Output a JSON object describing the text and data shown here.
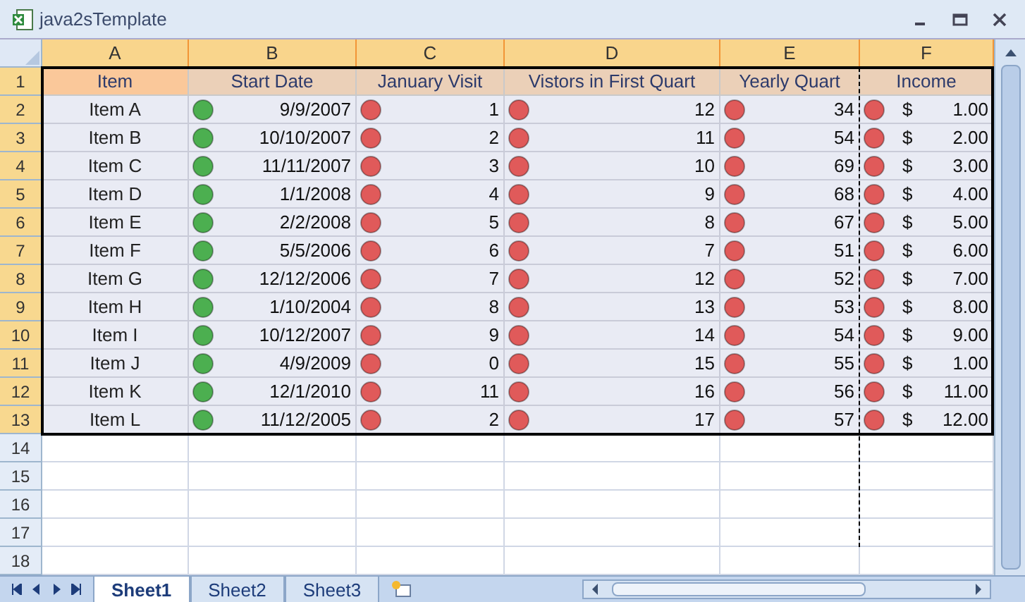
{
  "window": {
    "title": "java2sTemplate"
  },
  "columns": [
    {
      "label": "A",
      "selected": true
    },
    {
      "label": "B",
      "selected": true
    },
    {
      "label": "C",
      "selected": true
    },
    {
      "label": "D",
      "selected": true
    },
    {
      "label": "E",
      "selected": true
    },
    {
      "label": "F",
      "selected": true
    }
  ],
  "header_row": {
    "number": "1",
    "selected": true,
    "cells": [
      "Item",
      "Start Date",
      "January Visit",
      "Vistors in First Quart",
      "Yearly Quart",
      "Income"
    ]
  },
  "rows": [
    {
      "number": "2",
      "selected": true,
      "item": "Item A",
      "cells": [
        {
          "text": "9/9/2007",
          "color": "#4caf50"
        },
        {
          "text": "1",
          "color": "#e05a5a"
        },
        {
          "text": "12",
          "color": "#e05a5a"
        },
        {
          "text": "34",
          "color": "#e05a5a"
        },
        {
          "currency": "$",
          "text": "1.00",
          "color": "#e05a5a"
        }
      ]
    },
    {
      "number": "3",
      "selected": true,
      "item": "Item B",
      "cells": [
        {
          "text": "10/10/2007",
          "color": "#4caf50"
        },
        {
          "text": "2",
          "color": "#e05a5a"
        },
        {
          "text": "11",
          "color": "#e05a5a"
        },
        {
          "text": "54",
          "color": "#e05a5a"
        },
        {
          "currency": "$",
          "text": "2.00",
          "color": "#e05a5a"
        }
      ]
    },
    {
      "number": "4",
      "selected": true,
      "item": "Item C",
      "cells": [
        {
          "text": "11/11/2007",
          "color": "#4caf50"
        },
        {
          "text": "3",
          "color": "#e05a5a"
        },
        {
          "text": "10",
          "color": "#e05a5a"
        },
        {
          "text": "69",
          "color": "#e05a5a"
        },
        {
          "currency": "$",
          "text": "3.00",
          "color": "#e05a5a"
        }
      ]
    },
    {
      "number": "5",
      "selected": true,
      "item": "Item D",
      "cells": [
        {
          "text": "1/1/2008",
          "color": "#4caf50"
        },
        {
          "text": "4",
          "color": "#e05a5a"
        },
        {
          "text": "9",
          "color": "#e05a5a"
        },
        {
          "text": "68",
          "color": "#e05a5a"
        },
        {
          "currency": "$",
          "text": "4.00",
          "color": "#e05a5a"
        }
      ]
    },
    {
      "number": "6",
      "selected": true,
      "item": "Item E",
      "cells": [
        {
          "text": "2/2/2008",
          "color": "#4caf50"
        },
        {
          "text": "5",
          "color": "#e05a5a"
        },
        {
          "text": "8",
          "color": "#e05a5a"
        },
        {
          "text": "67",
          "color": "#e05a5a"
        },
        {
          "currency": "$",
          "text": "5.00",
          "color": "#e05a5a"
        }
      ]
    },
    {
      "number": "7",
      "selected": true,
      "item": "Item F",
      "cells": [
        {
          "text": "5/5/2006",
          "color": "#4caf50"
        },
        {
          "text": "6",
          "color": "#e05a5a"
        },
        {
          "text": "7",
          "color": "#e05a5a"
        },
        {
          "text": "51",
          "color": "#e05a5a"
        },
        {
          "currency": "$",
          "text": "6.00",
          "color": "#e05a5a"
        }
      ]
    },
    {
      "number": "8",
      "selected": true,
      "item": "Item G",
      "cells": [
        {
          "text": "12/12/2006",
          "color": "#4caf50"
        },
        {
          "text": "7",
          "color": "#e05a5a"
        },
        {
          "text": "12",
          "color": "#e05a5a"
        },
        {
          "text": "52",
          "color": "#e05a5a"
        },
        {
          "currency": "$",
          "text": "7.00",
          "color": "#e05a5a"
        }
      ]
    },
    {
      "number": "9",
      "selected": true,
      "item": "Item H",
      "cells": [
        {
          "text": "1/10/2004",
          "color": "#4caf50"
        },
        {
          "text": "8",
          "color": "#e05a5a"
        },
        {
          "text": "13",
          "color": "#e05a5a"
        },
        {
          "text": "53",
          "color": "#e05a5a"
        },
        {
          "currency": "$",
          "text": "8.00",
          "color": "#e05a5a"
        }
      ]
    },
    {
      "number": "10",
      "selected": true,
      "item": "Item I",
      "cells": [
        {
          "text": "10/12/2007",
          "color": "#4caf50"
        },
        {
          "text": "9",
          "color": "#e05a5a"
        },
        {
          "text": "14",
          "color": "#e05a5a"
        },
        {
          "text": "54",
          "color": "#e05a5a"
        },
        {
          "currency": "$",
          "text": "9.00",
          "color": "#e05a5a"
        }
      ]
    },
    {
      "number": "11",
      "selected": true,
      "item": "Item J",
      "cells": [
        {
          "text": "4/9/2009",
          "color": "#4caf50"
        },
        {
          "text": "0",
          "color": "#e05a5a"
        },
        {
          "text": "15",
          "color": "#e05a5a"
        },
        {
          "text": "55",
          "color": "#e05a5a"
        },
        {
          "currency": "$",
          "text": "1.00",
          "color": "#e05a5a"
        }
      ]
    },
    {
      "number": "12",
      "selected": true,
      "item": "Item K",
      "cells": [
        {
          "text": "12/1/2010",
          "color": "#4caf50"
        },
        {
          "text": "11",
          "color": "#e05a5a"
        },
        {
          "text": "16",
          "color": "#e05a5a"
        },
        {
          "text": "56",
          "color": "#e05a5a"
        },
        {
          "currency": "$",
          "text": "11.00",
          "color": "#e05a5a"
        }
      ]
    },
    {
      "number": "13",
      "selected": true,
      "item": "Item L",
      "cells": [
        {
          "text": "11/12/2005",
          "color": "#4caf50"
        },
        {
          "text": "2",
          "color": "#e05a5a"
        },
        {
          "text": "17",
          "color": "#e05a5a"
        },
        {
          "text": "57",
          "color": "#e05a5a"
        },
        {
          "currency": "$",
          "text": "12.00",
          "color": "#e05a5a"
        }
      ]
    }
  ],
  "empty_rows": [
    {
      "number": "14",
      "selected": false
    },
    {
      "number": "15",
      "selected": false
    },
    {
      "number": "16",
      "selected": false
    },
    {
      "number": "17",
      "selected": false
    },
    {
      "number": "18",
      "selected": false
    }
  ],
  "sheet_tabs": [
    {
      "label": "Sheet1",
      "selected": true
    },
    {
      "label": "Sheet2",
      "selected": false
    },
    {
      "label": "Sheet3",
      "selected": false
    }
  ]
}
